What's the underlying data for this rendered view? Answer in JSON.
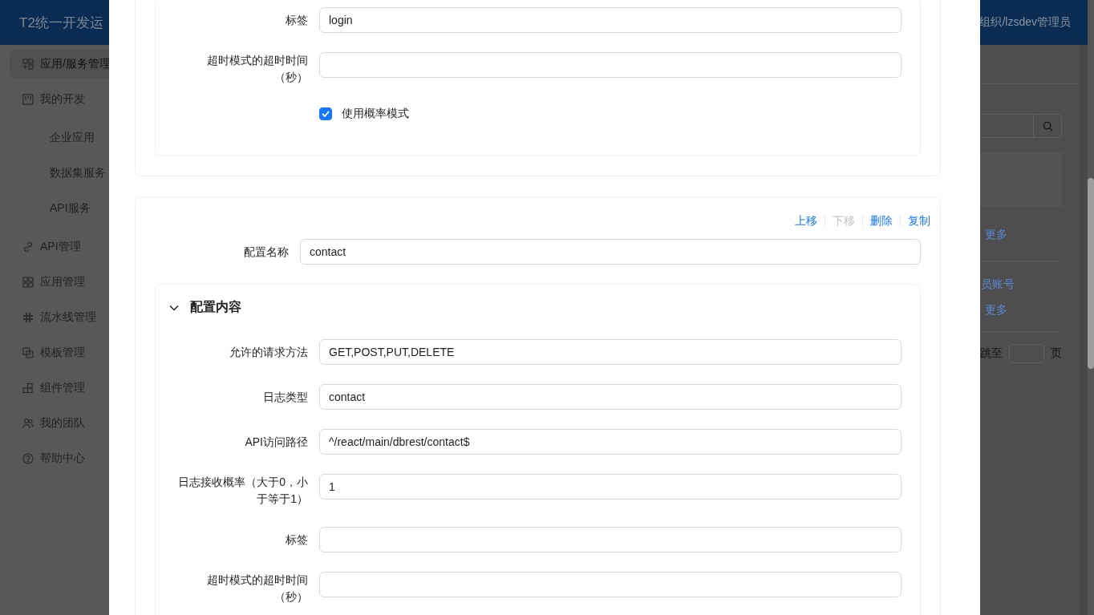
{
  "header": {
    "title": "T2统一开发运",
    "user": "组织/lzsdev管理员"
  },
  "sidebar": {
    "items": [
      {
        "label": "应用/服务管理",
        "selected": true
      },
      {
        "label": "我的开发",
        "selected": false,
        "children": [
          {
            "label": "企业应用",
            "selected": false
          },
          {
            "label": "数据集服务",
            "selected": false
          },
          {
            "label": "API服务",
            "selected": false
          }
        ]
      },
      {
        "label": "API管理",
        "selected": false
      },
      {
        "label": "应用管理",
        "selected": false
      },
      {
        "label": "流水线管理",
        "selected": false
      },
      {
        "label": "模板管理",
        "selected": false
      },
      {
        "label": "组件管理",
        "selected": false
      },
      {
        "label": "我的团队",
        "selected": false
      },
      {
        "label": "帮助中心",
        "selected": false
      }
    ]
  },
  "content": {
    "list": [
      {
        "links": [
          {
            "kind": "action",
            "label": "更多"
          }
        ]
      },
      {
        "links": [
          {
            "kind": "title",
            "label": "员账号"
          },
          {
            "kind": "action",
            "label": "更多"
          }
        ]
      }
    ],
    "pager": {
      "jump_label": "跳至",
      "page_label": "页"
    }
  },
  "dialog": {
    "sections": [
      {
        "panel": {
          "fields": [
            {
              "label": "标签",
              "value": "login"
            },
            {
              "label": "超时模式的超时时间（秒）"
            }
          ],
          "checkbox": {
            "label": "使用概率模式",
            "checked": true
          }
        }
      },
      {
        "actions": [
          {
            "label": "上移",
            "disabled": false
          },
          {
            "label": "下移",
            "disabled": true
          },
          {
            "label": "删除",
            "disabled": false
          },
          {
            "label": "复制",
            "disabled": false
          }
        ],
        "name_field": {
          "label": "配置名称",
          "value": "contact"
        },
        "panel": {
          "title": "配置内容",
          "expanded": true,
          "fields": [
            {
              "label": "允许的请求方法",
              "value": "GET,POST,PUT,DELETE"
            },
            {
              "label": "日志类型",
              "value": "contact"
            },
            {
              "label": "API访问路径",
              "value": "^/react/main/dbrest/contact$"
            },
            {
              "label": "日志接收概率（大于0，小于等于1）",
              "value": "1"
            },
            {
              "label": "标签"
            },
            {
              "label": "超时模式的超时时间（秒）"
            }
          ]
        }
      }
    ]
  }
}
